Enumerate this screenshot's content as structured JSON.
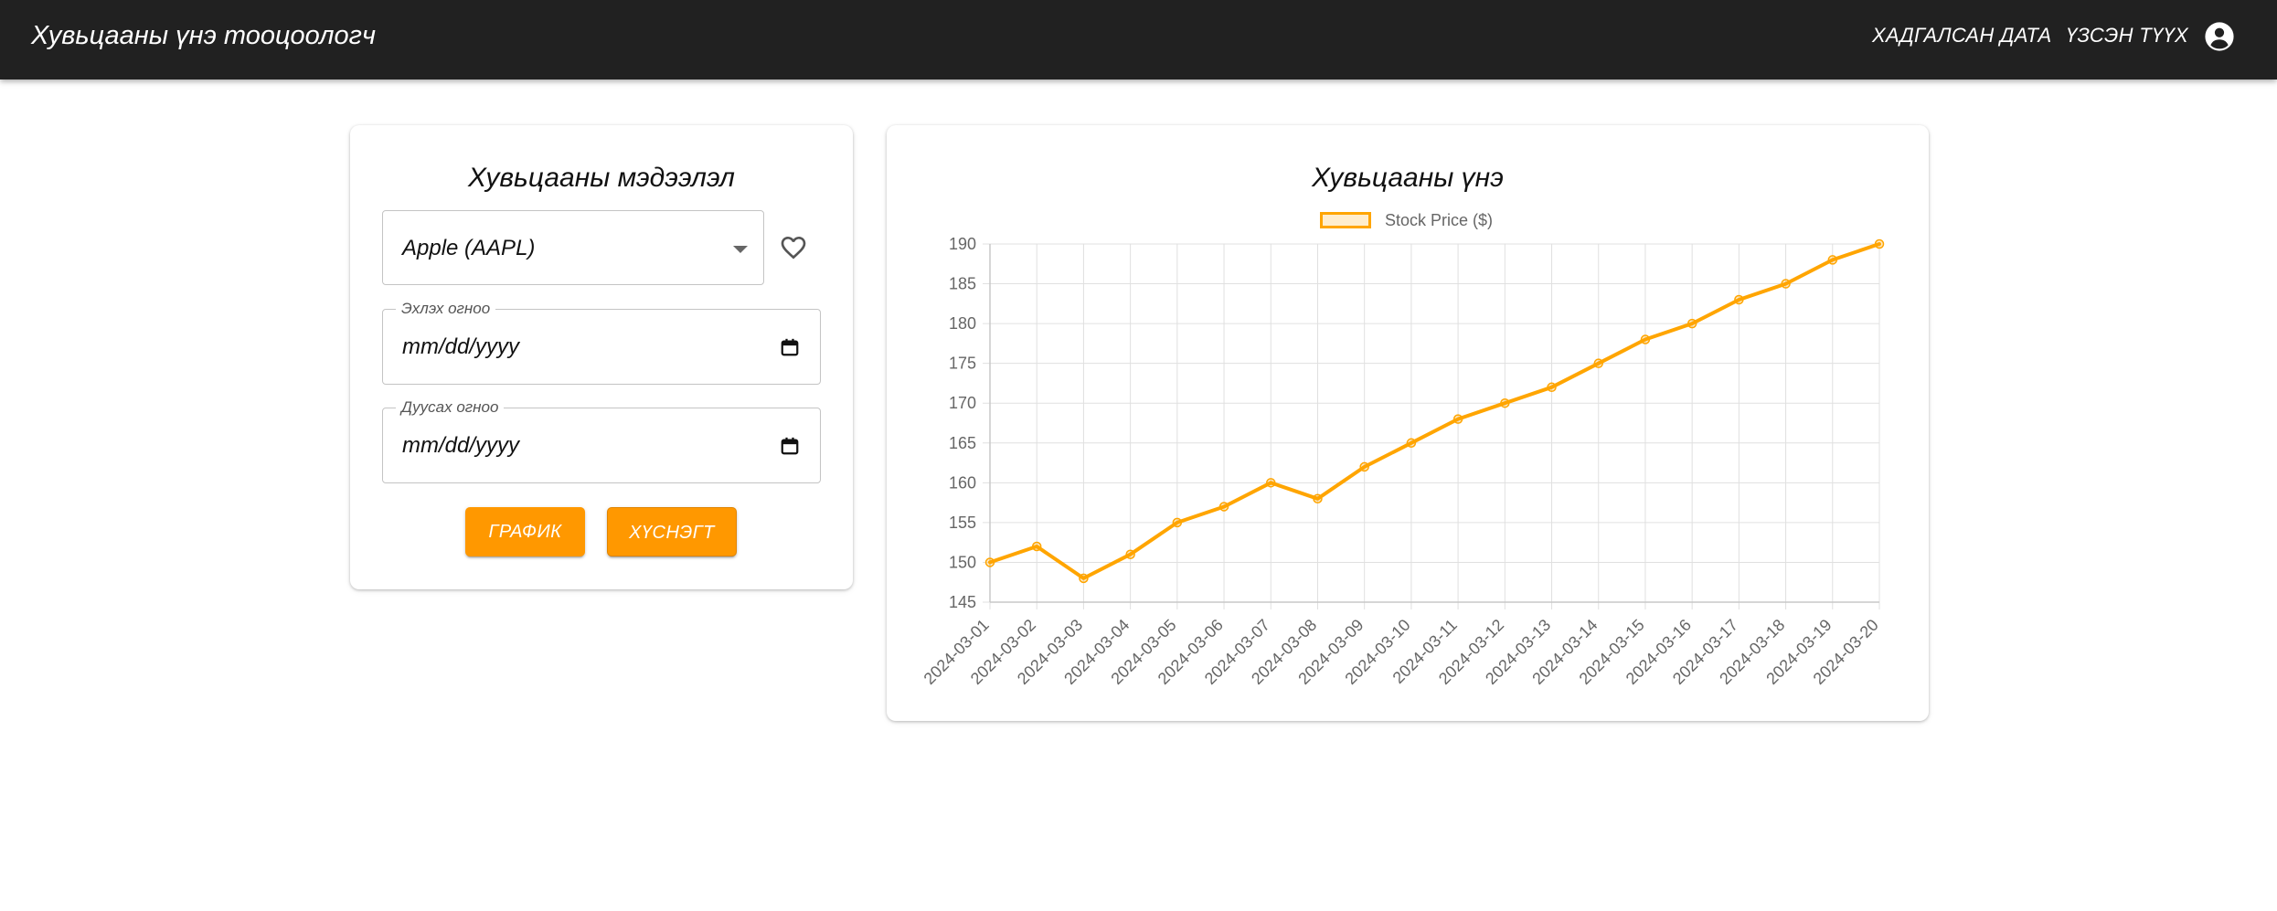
{
  "header": {
    "title": "Хувьцааны үнэ тооцоологч",
    "nav": {
      "saved_data": "ХАДГАЛСАН ДАТА",
      "history": "ҮЗСЭН ТҮҮХ"
    }
  },
  "form": {
    "title": "Хувьцааны мэдээлэл",
    "stock_select": {
      "value": "Apple (AAPL)"
    },
    "start_date": {
      "label": "Эхлэх огноо",
      "placeholder": "mm/dd/yyyy"
    },
    "end_date": {
      "label": "Дуусах огноо",
      "placeholder": "mm/dd/yyyy"
    },
    "buttons": {
      "chart": "ГРАФИК",
      "table": "ХҮСНЭГТ"
    }
  },
  "chart_panel": {
    "title": "Хувьцааны үнэ"
  },
  "chart_data": {
    "type": "line",
    "title": "Хувьцааны үнэ",
    "legend_position": "top",
    "grid": true,
    "color": "#ffa500",
    "x": [
      "2024-03-01",
      "2024-03-02",
      "2024-03-03",
      "2024-03-04",
      "2024-03-05",
      "2024-03-06",
      "2024-03-07",
      "2024-03-08",
      "2024-03-09",
      "2024-03-10",
      "2024-03-11",
      "2024-03-12",
      "2024-03-13",
      "2024-03-14",
      "2024-03-15",
      "2024-03-16",
      "2024-03-17",
      "2024-03-18",
      "2024-03-19",
      "2024-03-20"
    ],
    "series": [
      {
        "name": "Stock Price ($)",
        "values": [
          150,
          152,
          148,
          151,
          155,
          157,
          160,
          158,
          162,
          165,
          168,
          170,
          172,
          175,
          178,
          180,
          183,
          185,
          188,
          190
        ]
      }
    ],
    "ylim": [
      145,
      190
    ],
    "yticks": [
      145,
      150,
      155,
      160,
      165,
      170,
      175,
      180,
      185,
      190
    ]
  }
}
